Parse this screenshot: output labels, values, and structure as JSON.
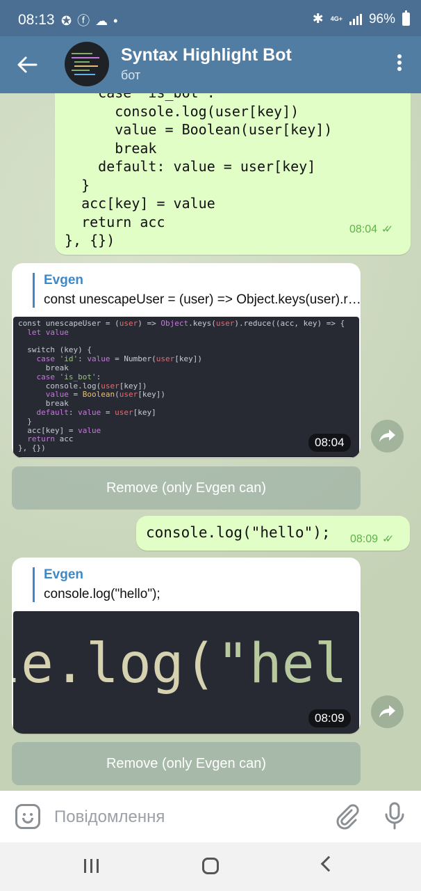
{
  "status_bar": {
    "time": "08:13",
    "battery": "96%",
    "network": "4G+"
  },
  "header": {
    "title": "Syntax Highlight Bot",
    "subtitle": "бот"
  },
  "messages": {
    "code_top": {
      "text": "    case 'is_bot':\n      console.log(user[key])\n      value = Boolean(user[key])\n      break\n    default: value = user[key]\n  }\n  acc[key] = value\n  return acc\n}, {})",
      "time": "08:04"
    },
    "image_msg_1": {
      "reply_name": "Evgen",
      "reply_text": "const unescapeUser = (user) => Object.keys(user).reduce((acc, key) => {",
      "time": "08:04"
    },
    "button_1": {
      "label": "Remove (only Evgen can)"
    },
    "hello": {
      "text": "console.log(\"hello\");",
      "time": "08:09"
    },
    "image_msg_2": {
      "reply_name": "Evgen",
      "reply_text": "console.log(\"hello\");",
      "time": "08:09"
    },
    "button_2": {
      "label": "Remove (only Evgen can)"
    }
  },
  "composer": {
    "placeholder": "Повідомлення"
  },
  "colors": {
    "header": "#517da2",
    "status_bar": "#4b6f92",
    "outgoing_bubble": "#e1fec6",
    "accent": "#3e88c7",
    "read_check": "#5fb14a"
  },
  "icons": [
    "back-arrow-icon",
    "more-vert-icon",
    "forward-icon",
    "emoji-icon",
    "attach-icon",
    "mic-icon",
    "double-check-icon"
  ]
}
